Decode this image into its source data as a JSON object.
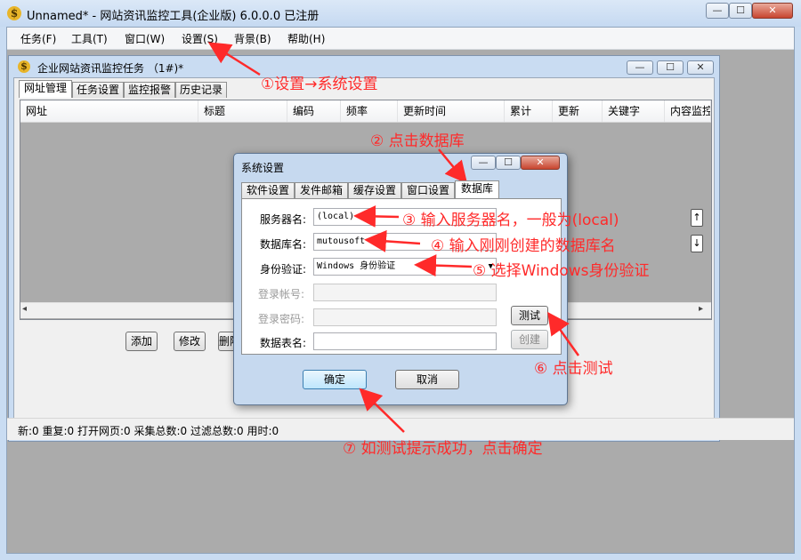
{
  "app": {
    "title": "Unnamed* - 网站资讯监控工具(企业版) 6.0.0.0 已注册",
    "icon_glyph": "$",
    "caption_buttons": {
      "minimize": "—",
      "maximize": "☐",
      "close": "✕"
    }
  },
  "menu": {
    "items": [
      {
        "label": "任务(F)"
      },
      {
        "label": "工具(T)"
      },
      {
        "label": "窗口(W)"
      },
      {
        "label": "设置(S)"
      },
      {
        "label": "背景(B)"
      },
      {
        "label": "帮助(H)"
      }
    ]
  },
  "child": {
    "title": "企业网站资讯监控任务 （1#)*",
    "tabs": [
      {
        "label": "网址管理",
        "active": true
      },
      {
        "label": "任务设置"
      },
      {
        "label": "监控报警"
      },
      {
        "label": "历史记录"
      }
    ],
    "columns": [
      "网址",
      "标题",
      "编码",
      "频率",
      "更新时间",
      "累计",
      "更新",
      "关键字",
      "内容监控"
    ],
    "buttons": {
      "add": "添加",
      "edit": "修改",
      "delete": "删除"
    },
    "scroll_left": "◂",
    "scroll_right": "▸"
  },
  "status": {
    "text": "新:0 重复:0 打开网页:0 采集总数:0 过滤总数:0 用时:0"
  },
  "dialog": {
    "title": "系统设置",
    "tabs": [
      {
        "label": "软件设置"
      },
      {
        "label": "发件邮箱"
      },
      {
        "label": "缓存设置"
      },
      {
        "label": "窗口设置"
      },
      {
        "label": "数据库",
        "active": true
      }
    ],
    "fields": {
      "server": {
        "label": "服务器名:",
        "value": "(local)"
      },
      "database": {
        "label": "数据库名:",
        "value": "mutousoft"
      },
      "auth": {
        "label": "身份验证:",
        "value": "Windows 身份验证"
      },
      "login": {
        "label": "登录帐号:",
        "value": ""
      },
      "password": {
        "label": "登录密码:",
        "value": ""
      },
      "table": {
        "label": "数据表名:",
        "value": ""
      }
    },
    "buttons": {
      "test": "测试",
      "create": "创建",
      "ok": "确定",
      "cancel": "取消"
    },
    "up_arrow": "↑",
    "down_arrow": "↓"
  },
  "annotations": {
    "a1": "①设置→系统设置",
    "a2": "② 点击数据库",
    "a3": "③ 输入服务器名，一般为(local)",
    "a4": "④ 输入刚刚创建的数据库名",
    "a5": "⑤ 选择Windows身份验证",
    "a6": "⑥ 点击测试",
    "a7": "⑦ 如测试提示成功，点击确定"
  },
  "colors": {
    "annotation": "#ff2a2a",
    "window_frame": "#c9dcf2",
    "workspace": "#ababab"
  }
}
